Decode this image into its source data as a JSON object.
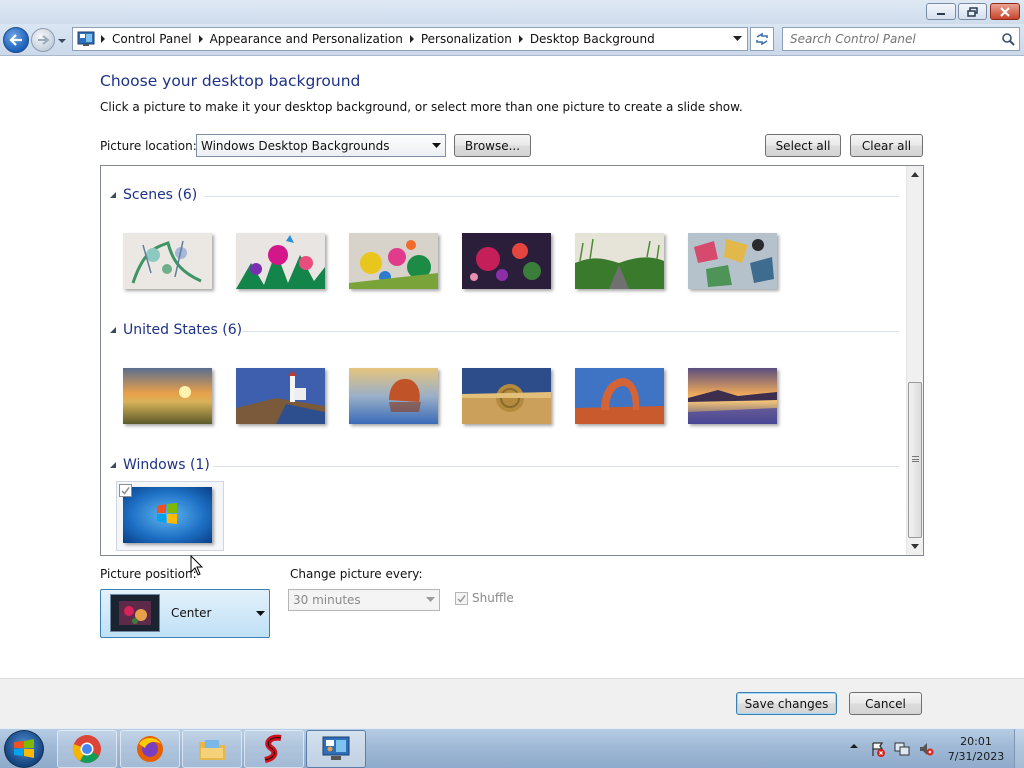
{
  "window": {
    "minimize": "minimize",
    "maximize": "restore",
    "close": "close"
  },
  "address": {
    "crumbs": [
      "Control Panel",
      "Appearance and Personalization",
      "Personalization",
      "Desktop Background"
    ],
    "search_placeholder": "Search Control Panel"
  },
  "page": {
    "title": "Choose your desktop background",
    "subtitle": "Click a picture to make it your desktop background, or select more than one picture to create a slide show.",
    "picture_location_label": "Picture location:",
    "picture_location_value": "Windows Desktop Backgrounds",
    "browse_label": "Browse...",
    "select_all_label": "Select all",
    "clear_all_label": "Clear all"
  },
  "groups": [
    {
      "title": "Scenes (6)",
      "items": [
        {
          "name": "scene-1",
          "colors": [
            "#e9e7e2",
            "#8fc7c0",
            "#3f9a62"
          ]
        },
        {
          "name": "scene-2",
          "colors": [
            "#e6e3e0",
            "#d0168a",
            "#1c8a4a"
          ]
        },
        {
          "name": "scene-3",
          "colors": [
            "#d7d2c9",
            "#e03a8a",
            "#e9c21a"
          ]
        },
        {
          "name": "scene-4",
          "colors": [
            "#2a1e3a",
            "#c71f5a",
            "#3c7b3a"
          ]
        },
        {
          "name": "scene-5",
          "colors": [
            "#e5e4d9",
            "#3a7a2e",
            "#6a6a6a"
          ]
        },
        {
          "name": "scene-6",
          "colors": [
            "#b7c3cc",
            "#d54a6d",
            "#e3b84a"
          ]
        }
      ]
    },
    {
      "title": "United States (6)",
      "items": [
        {
          "name": "us-1",
          "colors": [
            "#e7a34a",
            "#e9d25c",
            "#6a6a2e"
          ]
        },
        {
          "name": "us-2",
          "colors": [
            "#3b5fae",
            "#8ab4e0",
            "#7a5a3a"
          ]
        },
        {
          "name": "us-3",
          "colors": [
            "#e3c07a",
            "#3a6ab8",
            "#c2562a"
          ]
        },
        {
          "name": "us-4",
          "colors": [
            "#2f4f8c",
            "#caa05a",
            "#d4b46a"
          ]
        },
        {
          "name": "us-5",
          "colors": [
            "#3f74c4",
            "#c8552e",
            "#e58a4a"
          ]
        },
        {
          "name": "us-6",
          "colors": [
            "#584c7c",
            "#e8a65a",
            "#4a4a8c"
          ]
        }
      ]
    },
    {
      "title": "Windows (1)",
      "items": [
        {
          "name": "windows-7",
          "colors": [
            "#0b4f9c",
            "#2d8ee0",
            "#6cc0f0"
          ],
          "checked": true
        }
      ]
    }
  ],
  "options": {
    "picture_position_label": "Picture position:",
    "picture_position_value": "Center",
    "change_every_label": "Change picture every:",
    "change_every_value": "30 minutes",
    "shuffle_label": "Shuffle",
    "shuffle_checked": true
  },
  "footer": {
    "save_label": "Save changes",
    "cancel_label": "Cancel"
  },
  "taskbar": {
    "apps": [
      "chrome-icon",
      "firefox-icon",
      "file-explorer-icon",
      "red-s-app-icon",
      "control-panel-icon"
    ],
    "time": "20:01",
    "date": "7/31/2023"
  }
}
